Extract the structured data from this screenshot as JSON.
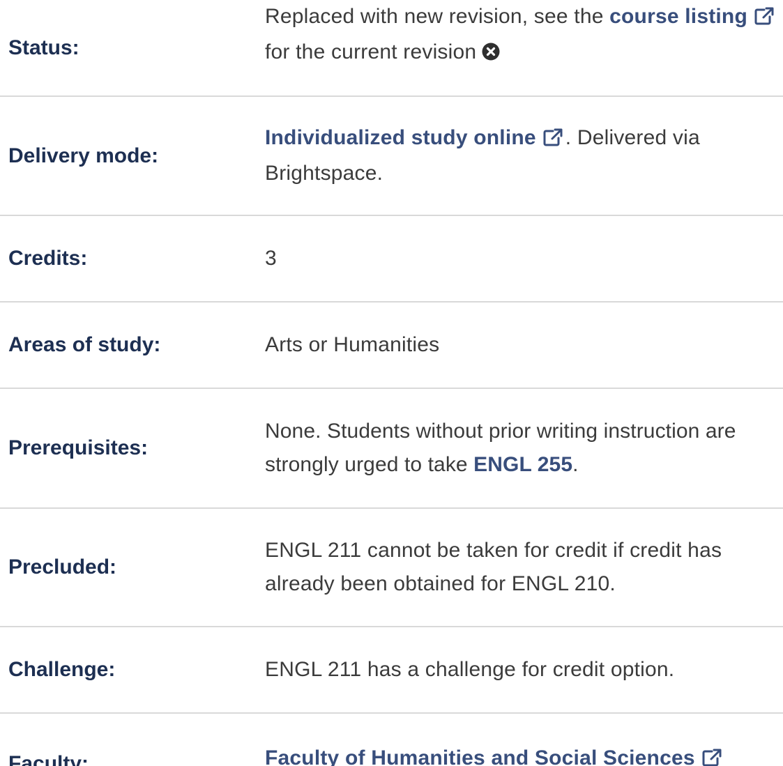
{
  "rows": {
    "status": {
      "label": "Status:",
      "text_before": "Replaced with new revision, see the ",
      "link_text": "course listing",
      "text_after": " for the current revision"
    },
    "delivery": {
      "label": "Delivery mode:",
      "link_text": "Individualized study online",
      "text_after": ". Delivered via Brightspace."
    },
    "credits": {
      "label": "Credits:",
      "value": "3"
    },
    "areas": {
      "label": "Areas of study:",
      "value": "Arts or Humanities"
    },
    "prereq": {
      "label": "Prerequisites:",
      "text_before": "None. Students without prior writing instruction are strongly urged to take ",
      "link_text": "ENGL 255",
      "text_after": "."
    },
    "precluded": {
      "label": "Precluded:",
      "value": "ENGL 211 cannot be taken for credit if credit has already been obtained for ENGL 210."
    },
    "challenge": {
      "label": "Challenge:",
      "value": "ENGL 211 has a challenge for credit option."
    },
    "faculty": {
      "label": "Faculty:",
      "link_text": "Faculty of Humanities and Social Sciences"
    }
  },
  "icons": {
    "external_link": "external-link-icon",
    "dismiss": "times-circle-icon"
  },
  "colors": {
    "label": "#1d2f52",
    "link": "#384e7c",
    "text": "#3b3b3b",
    "divider": "#d9d9d9"
  }
}
